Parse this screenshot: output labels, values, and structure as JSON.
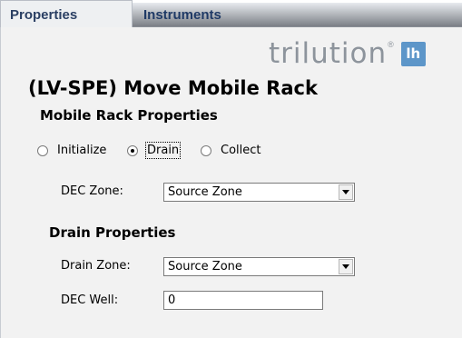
{
  "tabs": [
    {
      "label": "Properties",
      "active": true
    },
    {
      "label": "Instruments",
      "active": false
    }
  ],
  "logo": {
    "text": "trilution",
    "mark": "lh",
    "registered": "®"
  },
  "header": {
    "title": "(LV-SPE) Move Mobile Rack",
    "subtitle": "Mobile Rack Properties"
  },
  "mode_radios": [
    {
      "label": "Initialize",
      "checked": false
    },
    {
      "label": "Drain",
      "checked": true
    },
    {
      "label": "Collect",
      "checked": false
    }
  ],
  "dec_zone": {
    "label": "DEC Zone:",
    "value": "Source Zone"
  },
  "drain_section": {
    "title": "Drain Properties",
    "drain_zone": {
      "label": "Drain Zone:",
      "value": "Source Zone"
    },
    "dec_well": {
      "label": "DEC Well:",
      "value": "0"
    }
  },
  "colors": {
    "accent": "#5d96c9",
    "tab_text": "#2a3f63",
    "panel_bg": "#f2f2f2"
  }
}
